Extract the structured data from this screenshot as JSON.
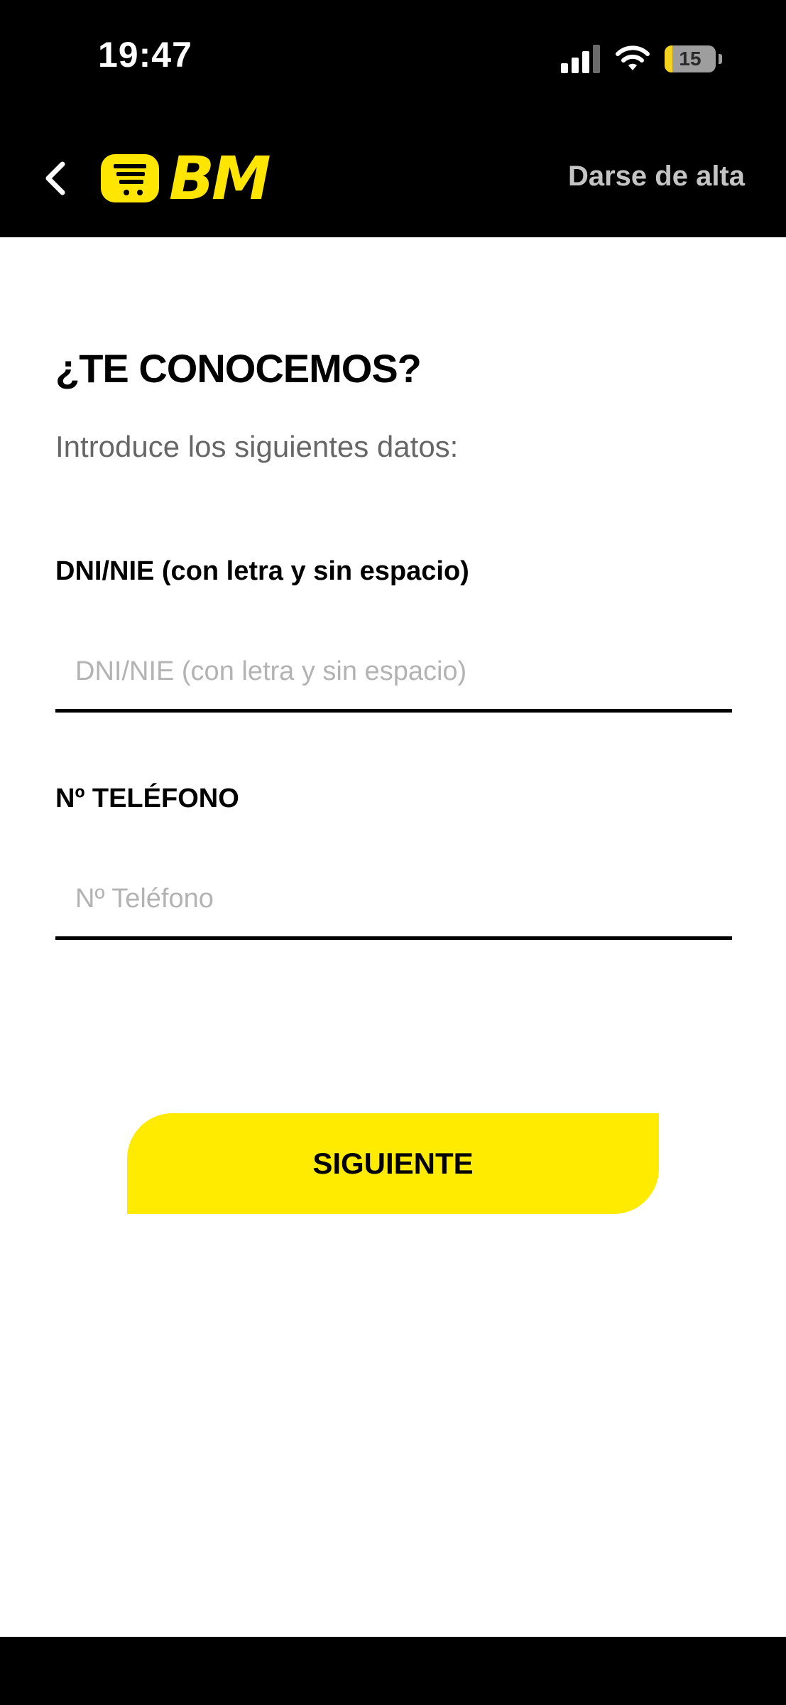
{
  "status_bar": {
    "time": "19:47",
    "battery_level": "15",
    "icons": [
      "cellular-signal-icon",
      "wifi-icon",
      "battery-icon"
    ]
  },
  "nav": {
    "back_icon": "chevron-left-icon",
    "logo_text": "BM",
    "logo_icon": "shopping-cart-icon",
    "signup_label": "Darse de alta"
  },
  "main": {
    "title": "¿TE CONOCEMOS?",
    "subtitle": "Introduce los siguientes datos:",
    "fields": [
      {
        "label": "DNI/NIE (con letra y sin espacio)",
        "value": "",
        "placeholder": "DNI/NIE (con letra y sin espacio)"
      },
      {
        "label": "Nº TELÉFONO",
        "value": "",
        "placeholder": "Nº Teléfono"
      }
    ],
    "next_label": "SIGUIENTE"
  },
  "colors": {
    "brand_yellow": "#ffeb00",
    "header_bg": "#000000",
    "signup_text": "#c4c4c4",
    "placeholder": "#b3b3b3"
  }
}
